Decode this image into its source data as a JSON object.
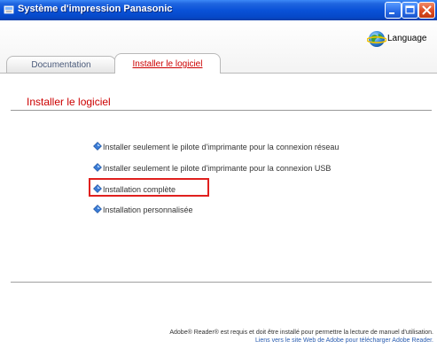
{
  "window": {
    "title": "Système d'impression Panasonic"
  },
  "header": {
    "language_label": "Language",
    "tabs": [
      {
        "label": "Documentation",
        "active": false
      },
      {
        "label": "Installer le logiciel",
        "active": true
      }
    ]
  },
  "main": {
    "title": "Installer le logiciel",
    "options": [
      {
        "label": "Installer seulement le pilote d'imprimante pour la connexion réseau"
      },
      {
        "label": "Installer seulement le pilote d'imprimante pour la connexion USB"
      },
      {
        "label": "Installation complète",
        "highlighted": true
      },
      {
        "label": "Installation personnalisée"
      }
    ]
  },
  "footer": {
    "notice": "Adobe® Reader® est requis et doit être installé pour permettre la lecture de manuel d'utilisation.",
    "link": "Liens vers le site Web de Adobe pour télécharger Adobe Reader."
  },
  "colors": {
    "accent_red": "#cc0000",
    "titlebar_blue": "#0a52d8",
    "highlight_border": "#e0201e",
    "link_blue": "#2a5db0"
  },
  "icons": {
    "app": "printer-app-icon",
    "language": "globe-icon",
    "bullet": "diamond-bullet-icon"
  }
}
